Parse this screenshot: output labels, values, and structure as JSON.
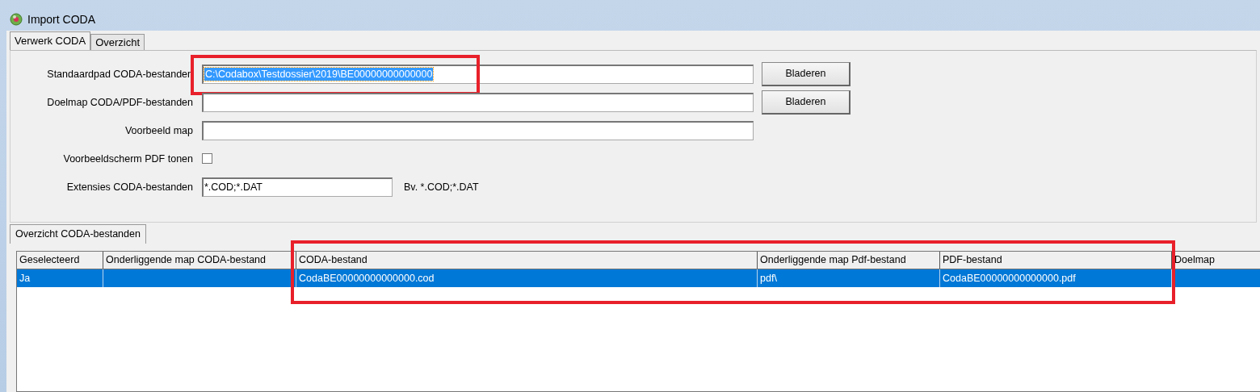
{
  "window": {
    "title": "Import CODA"
  },
  "tabs": [
    {
      "label": "Verwerk CODA",
      "selected": true
    },
    {
      "label": "Overzicht",
      "selected": false
    }
  ],
  "form": {
    "rows": [
      {
        "kind": "path",
        "label": "Standaardpad CODA-bestanden",
        "value": "C:\\Codabox\\Testdossier\\2019\\BE00000000000000",
        "text_selected": true,
        "highlighted": true,
        "button": "Bladeren"
      },
      {
        "kind": "path",
        "label": "Doelmap CODA/PDF-bestanden",
        "value": "",
        "button": "Bladeren"
      },
      {
        "kind": "text",
        "label": "Voorbeeld map",
        "value": ""
      },
      {
        "kind": "checkbox",
        "label": "Voorbeeldscherm PDF tonen",
        "checked": false
      },
      {
        "kind": "short",
        "label": "Extensies CODA-bestanden",
        "value": "*.COD;*.DAT",
        "hint": "Bv. *.COD;*.DAT"
      }
    ]
  },
  "lower_tabs": [
    {
      "label": "Overzicht CODA-bestanden",
      "selected": true
    }
  ],
  "table": {
    "columns": [
      {
        "label": "Geselecteerd",
        "highlighted": false
      },
      {
        "label": "Onderliggende map CODA-bestand",
        "highlighted": false
      },
      {
        "label": "CODA-bestand",
        "highlighted": true
      },
      {
        "label": "Onderliggende map Pdf-bestand",
        "highlighted": true
      },
      {
        "label": "PDF-bestand",
        "highlighted": true
      },
      {
        "label": "Doelmap",
        "highlighted": false
      }
    ],
    "rows": [
      {
        "selected": true,
        "cells": [
          "Ja",
          "",
          "CodaBE00000000000000.cod",
          "pdf\\",
          "CodaBE00000000000000.pdf",
          ""
        ]
      }
    ]
  }
}
